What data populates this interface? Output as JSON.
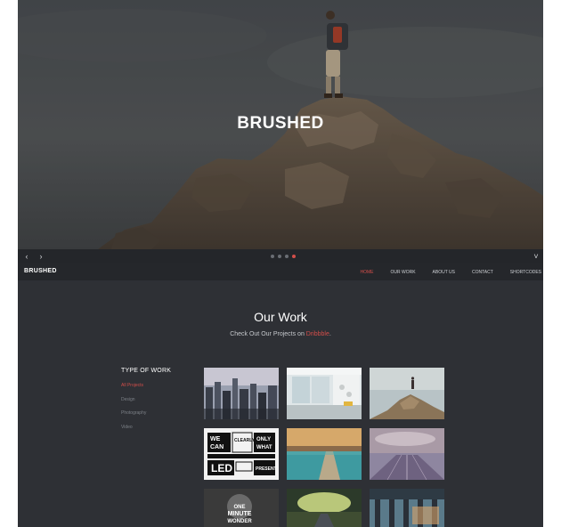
{
  "hero": {
    "title": "BRUSHED"
  },
  "slider": {
    "prev_icon": "‹",
    "next_icon": "›",
    "down_icon": "˅",
    "dot_count": 4,
    "active_dot": 4
  },
  "navbar": {
    "brand": "BRUSHED",
    "links": [
      "HOME",
      "OUR WORK",
      "ABOUT US",
      "CONTACT",
      "SHORTCODES"
    ],
    "active": "HOME"
  },
  "work": {
    "title": "Our Work",
    "subtitle_prefix": "Check Out Our Projects on ",
    "subtitle_link": "Dribbble",
    "subtitle_suffix": "."
  },
  "filter": {
    "title": "TYPE OF WORK",
    "items": [
      "All Projects",
      "Design",
      "Photography",
      "Video"
    ],
    "active": "All Projects"
  },
  "thumbs": {
    "typo": {
      "l1": "WE",
      "l2": "CAN",
      "l3": "CLEARLY",
      "l4": "ONLY",
      "l5": "WHAT",
      "l6": "LED",
      "l7": "PRESENT"
    },
    "minute": {
      "l1": "ONE",
      "l2": "MINUTE",
      "l3": "WONDER"
    }
  },
  "colors": {
    "accent": "#d24e4a",
    "background": "#2e3035",
    "navbar": "#25272b"
  }
}
